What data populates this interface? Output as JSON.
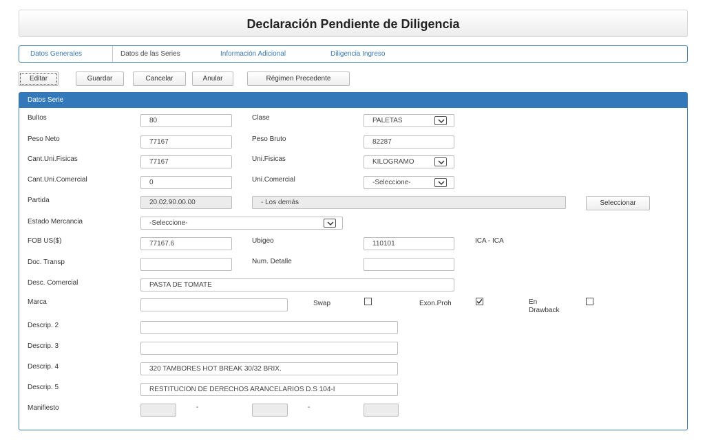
{
  "page": {
    "title": "Declaración Pendiente de Diligencia"
  },
  "tabs": [
    {
      "label": "Datos Generales"
    },
    {
      "label": "Datos de las Series"
    },
    {
      "label": "Información Adicional"
    },
    {
      "label": "Diligencia Ingreso"
    }
  ],
  "toolbar": {
    "editar": "Editar",
    "guardar": "Guardar",
    "cancelar": "Cancelar",
    "anular": "Anular",
    "regimen": "Régimen Precedente"
  },
  "panel": {
    "header": "Datos Serie"
  },
  "form": {
    "bultos": {
      "label": "Bultos",
      "value": "80"
    },
    "clase": {
      "label": "Clase",
      "value": "PALETAS"
    },
    "peso_neto": {
      "label": "Peso Neto",
      "value": "77167"
    },
    "peso_bruto": {
      "label": "Peso Bruto",
      "value": "82287"
    },
    "cant_fisicas": {
      "label": "Cant.Uni.Fisicas",
      "value": "77167"
    },
    "uni_fisicas": {
      "label": "Uni.Fisicas",
      "value": "KILOGRAMO"
    },
    "cant_comercial": {
      "label": "Cant.Uni.Comercial",
      "value": "0"
    },
    "uni_comercial": {
      "label": "Uni.Comercial",
      "value": "-Seleccione-"
    },
    "partida": {
      "label": "Partida",
      "code": "20.02.90.00.00",
      "desc": "- Los demás",
      "button": "Seleccionar"
    },
    "estado_mercancia": {
      "label": "Estado Mercancia",
      "value": "-Seleccione-"
    },
    "fob": {
      "label": "FOB US($)",
      "value": "77167.6"
    },
    "ubigeo": {
      "label": "Ubigeo",
      "value": "110101",
      "text": "ICA - ICA"
    },
    "doc_transp": {
      "label": "Doc. Transp",
      "value": ""
    },
    "num_detalle": {
      "label": "Num. Detalle",
      "value": ""
    },
    "desc_comercial": {
      "label": "Desc. Comercial",
      "value": "PASTA DE TOMATE"
    },
    "marca": {
      "label": "Marca",
      "value": ""
    },
    "swap": {
      "label": "Swap",
      "checked": false
    },
    "exon_proh": {
      "label": "Exon.Proh",
      "checked": true
    },
    "drawback": {
      "label_1": "En",
      "label_2": "Drawback",
      "checked": false
    },
    "descrip2": {
      "label": "Descrip. 2",
      "value": ""
    },
    "descrip3": {
      "label": "Descrip. 3",
      "value": ""
    },
    "descrip4": {
      "label": "Descrip. 4",
      "value": "320 TAMBORES HOT BREAK 30/32 BRIX."
    },
    "descrip5": {
      "label": "Descrip. 5",
      "value": "RESTITUCION DE DERECHOS ARANCELARIOS D.S 104-I"
    },
    "manifiesto": {
      "label": "Manifiesto",
      "sep": "-"
    }
  }
}
